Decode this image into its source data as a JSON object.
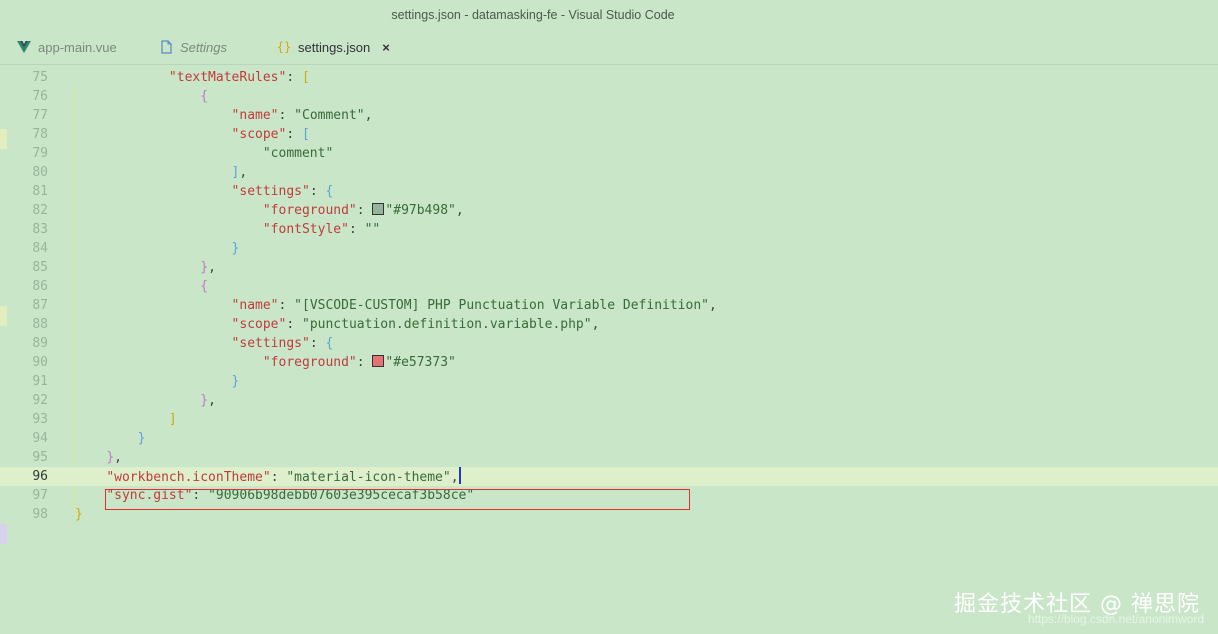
{
  "window": {
    "title": "settings.json - datamasking-fe - Visual Studio Code"
  },
  "tabs": [
    {
      "label": "app-main.vue",
      "icon": "vue-icon"
    },
    {
      "label": "Settings",
      "icon": "file-icon"
    },
    {
      "label": "settings.json",
      "icon": "json-braces-icon",
      "close": "×"
    }
  ],
  "editor": {
    "lines": [
      {
        "num": "75",
        "text": "\"textMateRules\": ["
      },
      {
        "num": "76",
        "text": "{"
      },
      {
        "num": "77",
        "text": "\"name\": \"Comment\","
      },
      {
        "num": "78",
        "text": "\"scope\": ["
      },
      {
        "num": "79",
        "text": "\"comment\""
      },
      {
        "num": "80",
        "text": "],"
      },
      {
        "num": "81",
        "text": "\"settings\": {"
      },
      {
        "num": "82",
        "text": "\"foreground\": \"#97b498\","
      },
      {
        "num": "83",
        "text": "\"fontStyle\": \"\""
      },
      {
        "num": "84",
        "text": "}"
      },
      {
        "num": "85",
        "text": "},"
      },
      {
        "num": "86",
        "text": "{"
      },
      {
        "num": "87",
        "text": "\"name\": \"[VSCODE-CUSTOM] PHP Punctuation Variable Definition\","
      },
      {
        "num": "88",
        "text": "\"scope\": \"punctuation.definition.variable.php\","
      },
      {
        "num": "89",
        "text": "\"settings\": {"
      },
      {
        "num": "90",
        "text": "\"foreground\": \"#e57373\""
      },
      {
        "num": "91",
        "text": "}"
      },
      {
        "num": "92",
        "text": "},"
      },
      {
        "num": "93",
        "text": "]"
      },
      {
        "num": "94",
        "text": "}"
      },
      {
        "num": "95",
        "text": "},"
      },
      {
        "num": "96",
        "text": "\"workbench.iconTheme\": \"material-icon-theme\","
      },
      {
        "num": "97",
        "text": "\"sync.gist\": \"90906b98debb07603e395cecaf3b58ce\""
      },
      {
        "num": "98",
        "text": "}"
      }
    ],
    "current_line": "96",
    "swatch_colors": [
      "#97b498",
      "#e57373"
    ]
  },
  "watermark": {
    "text": "掘金技术社区 @ 禅思院",
    "url": "https://blog.csdn.net/anonimword"
  }
}
